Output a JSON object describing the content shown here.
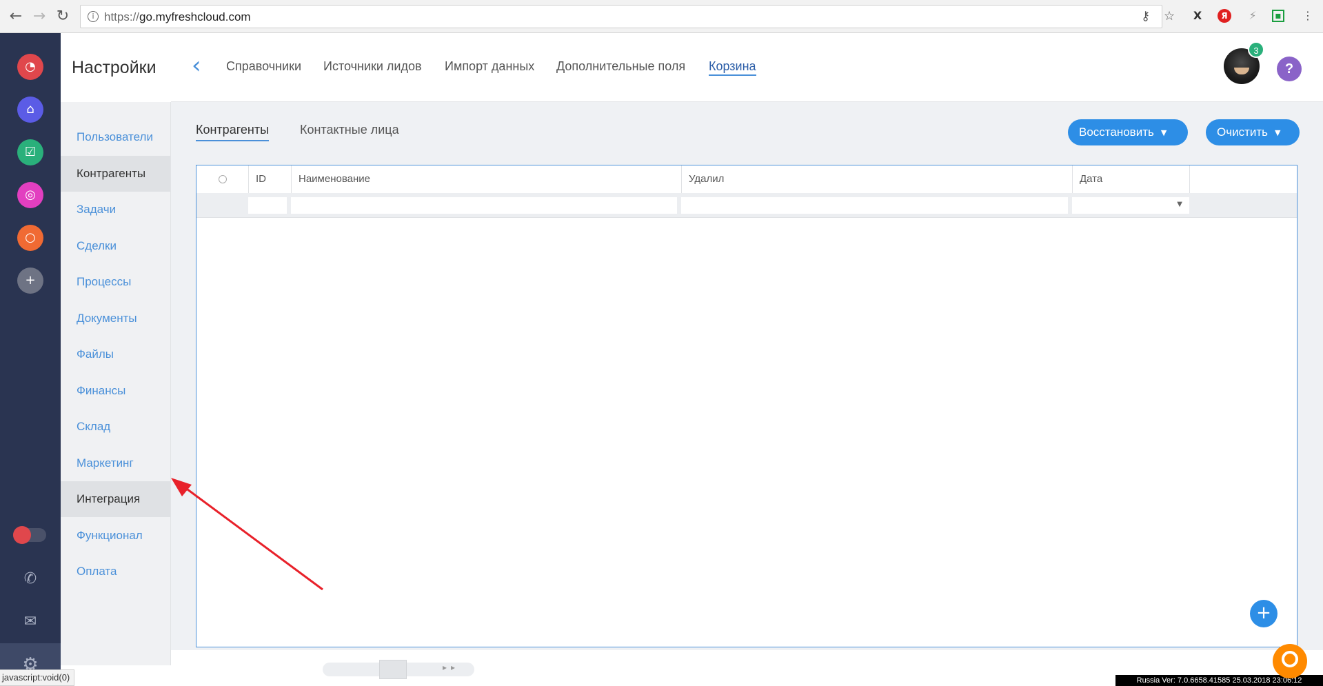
{
  "browser": {
    "url_scheme": "https://",
    "url_host": "go.myfreshcloud.com",
    "back_icon": "arrow-left-icon",
    "forward_icon": "arrow-right-icon",
    "reload_icon": "reload-icon"
  },
  "rail": {
    "apps": [
      {
        "name": "timer",
        "color": "#e0474c"
      },
      {
        "name": "home",
        "color": "#5b5ce6"
      },
      {
        "name": "tasks",
        "color": "#2ab07b"
      },
      {
        "name": "target",
        "color": "#e23fc0"
      },
      {
        "name": "circle",
        "color": "#f06a33"
      },
      {
        "name": "add",
        "color": "#6e7384"
      }
    ]
  },
  "sidebar": {
    "title": "Настройки",
    "items": [
      {
        "label": "Пользователи",
        "active": false
      },
      {
        "label": "Контрагенты",
        "active": true
      },
      {
        "label": "Задачи",
        "active": false
      },
      {
        "label": "Сделки",
        "active": false
      },
      {
        "label": "Процессы",
        "active": false
      },
      {
        "label": "Документы",
        "active": false
      },
      {
        "label": "Файлы",
        "active": false
      },
      {
        "label": "Финансы",
        "active": false
      },
      {
        "label": "Склад",
        "active": false
      },
      {
        "label": "Маркетинг",
        "active": false
      },
      {
        "label": "Интеграция",
        "active": true
      },
      {
        "label": "Функционал",
        "active": false
      },
      {
        "label": "Оплата",
        "active": false
      }
    ]
  },
  "header": {
    "tabs": [
      {
        "label": "Справочники",
        "active": false
      },
      {
        "label": "Источники лидов",
        "active": false
      },
      {
        "label": "Импорт данных",
        "active": false
      },
      {
        "label": "Дополнительные поля",
        "active": false
      },
      {
        "label": "Корзина",
        "active": true
      }
    ],
    "notification_count": "3",
    "help_label": "?"
  },
  "main": {
    "subtabs": [
      {
        "label": "Контрагенты",
        "active": true
      },
      {
        "label": "Контактные лица",
        "active": false
      }
    ],
    "restore_button": "Восстановить",
    "clear_button": "Очистить",
    "table": {
      "columns": [
        "ID",
        "Наименование",
        "Удалил",
        "Дата"
      ]
    },
    "fab_label": "+"
  },
  "status": {
    "link_preview": "javascript:void(0)",
    "version": "Russia Ver: 7.0.6658.41585 25.03.2018 23:06:12"
  },
  "colors": {
    "rail_bg": "#2a3451",
    "accent": "#2d8ee6",
    "link": "#4a90d9",
    "annotation": "#e8212a"
  }
}
